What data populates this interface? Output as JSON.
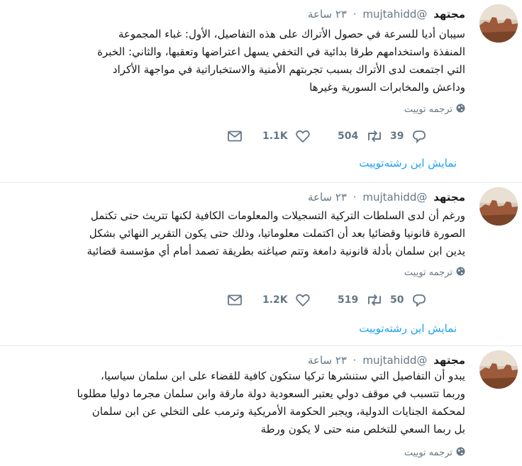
{
  "colors": {
    "link": "#1da1f2",
    "muted": "#657786",
    "text": "#14171a",
    "divider": "#e6ecf0"
  },
  "tweets": [
    {
      "name": "مجتهد",
      "handle": "@mujtahidd",
      "time": "٢٣ ساعة",
      "lines": [
        "سيبان أديا  للسرعة في حصول الأتراك على هذه التفاصيل، الأول: غباء المجموعة",
        "المنفذة واستخدامهم طرقا بدائية في التخفي يسهل اعتراضها وتعقبها، والثاني: الخبرة",
        "التي اجتمعت لدى الأتراك بسبب تجربتهم الأمنية والاستخباراتية في مواجهة الأكراد",
        "وداعش والمخابرات السورية وغيرها"
      ],
      "translate": "ترجمه توییت",
      "replies": "39",
      "retweets": "504",
      "likes": "1.1K",
      "show_thread": "نمایش این رشته‌توییت"
    },
    {
      "name": "مجتهد",
      "handle": "@mujtahidd",
      "time": "٢٣ ساعة",
      "lines": [
        "ورغم أن لدى السلطات التركية التسجيلات والمعلومات الكافية لكنها تتريث حتى تكتمل",
        "الصورة قانونيا وقضائيا بعد أن اكتملت معلوماتيا، وذلك حتى يكون التقرير النهائي بشكل",
        "يدين ابن سلمان بأدلة قانونية دامغة وتتم صياغته بطريقة تصمد أمام أي مؤسسة قضائية"
      ],
      "translate": "ترجمه توییت",
      "replies": "50",
      "retweets": "519",
      "likes": "1.2K",
      "show_thread": "نمایش این رشته‌توییت"
    },
    {
      "name": "مجتهد",
      "handle": "@mujtahidd",
      "time": "٢٣ ساعة",
      "lines": [
        "يبدو أن التفاصيل التي ستنشرها تركيا ستكون كافية للقضاء على ابن سلمان سياسيا،",
        "وربما تتسبب في موقف دولي يعتبر السعودية دولة مارقة وابن سلمان مجرما دوليا مطلوبا",
        "لمحكمة الجنايات الدولية، ويجبر الحكومة الأمريكية وترمب على التخلي عن ابن سلمان",
        "بل ربما السعي للتخلص منه حتى لا يكون ورطة"
      ],
      "translate": "ترجمه توییت"
    }
  ]
}
